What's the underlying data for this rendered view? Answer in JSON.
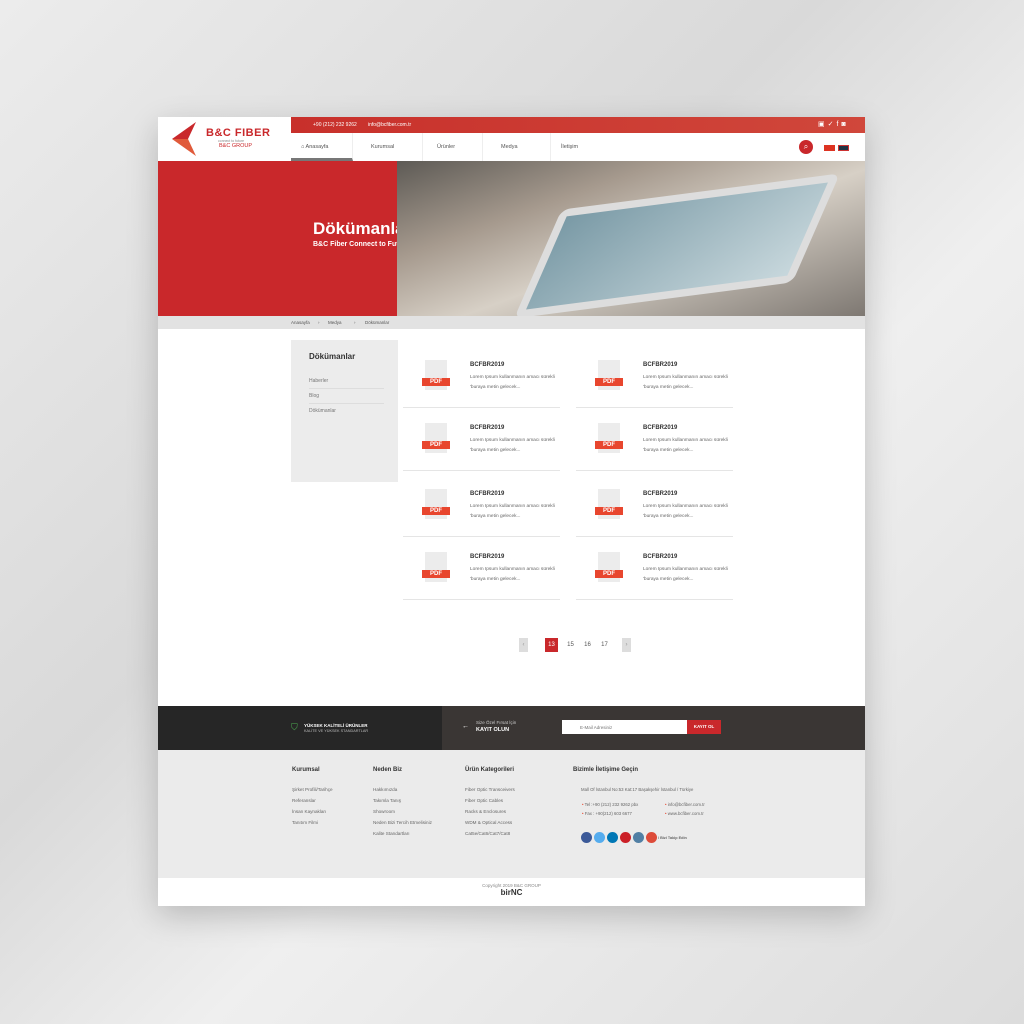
{
  "topbar": {
    "phone": "+90 (212) 232 9262",
    "email": "info@bcfiber.com.tr",
    "social": [
      "linkedin-icon",
      "twitter-icon",
      "facebook-icon",
      "instagram-icon"
    ]
  },
  "logo": {
    "name": "B&C FIBER",
    "tagline": "connect to future",
    "group": "B&C GROUP"
  },
  "nav": {
    "items": [
      "Anasayfa",
      "Kurumsal",
      "Ürünler",
      "Medya",
      "İletişim"
    ]
  },
  "hero": {
    "title": "Dökümanlar",
    "subtitle": "B&C Fiber Connect to Future"
  },
  "breadcrumb": [
    "Anasayfa",
    "Medya",
    "Dökümanlar"
  ],
  "sidebar": {
    "title": "Dökümanlar",
    "items": [
      "Haberler",
      "Blog",
      "Dökümanlar"
    ]
  },
  "documents": [
    {
      "badge": "PDF",
      "title": "BCFBR2019",
      "desc": "Lorem Ipsum kullanmanın amacı sürekli 'buraya metin gelecek..."
    },
    {
      "badge": "PDF",
      "title": "BCFBR2019",
      "desc": "Lorem Ipsum kullanmanın amacı sürekli 'buraya metin gelecek..."
    },
    {
      "badge": "PDF",
      "title": "BCFBR2019",
      "desc": "Lorem Ipsum kullanmanın amacı sürekli 'buraya metin gelecek..."
    },
    {
      "badge": "PDF",
      "title": "BCFBR2019",
      "desc": "Lorem Ipsum kullanmanın amacı sürekli 'buraya metin gelecek..."
    },
    {
      "badge": "PDF",
      "title": "BCFBR2019",
      "desc": "Lorem Ipsum kullanmanın amacı sürekli 'buraya metin gelecek..."
    },
    {
      "badge": "PDF",
      "title": "BCFBR2019",
      "desc": "Lorem Ipsum kullanmanın amacı sürekli 'buraya metin gelecek..."
    },
    {
      "badge": "PDF",
      "title": "BCFBR2019",
      "desc": "Lorem Ipsum kullanmanın amacı sürekli 'buraya metin gelecek..."
    },
    {
      "badge": "PDF",
      "title": "BCFBR2019",
      "desc": "Lorem Ipsum kullanmanın amacı sürekli 'buraya metin gelecek..."
    }
  ],
  "pagination": {
    "pages": [
      "13",
      "15",
      "16",
      "17"
    ],
    "current": "13",
    "prev": "‹",
    "next": "›"
  },
  "band": {
    "quality_title": "YÜKSEK KALİTELİ ÜRÜNLER",
    "quality_sub": "KALİTE VE YÜKSEK STANDARTLAR",
    "promo_small": "Size Özel Fırsat İçin",
    "promo_big": "KAYIT OLUN",
    "email_placeholder": "E-Mail Adresiniz",
    "submit": "KAYIT OL"
  },
  "footer": {
    "cols": [
      {
        "title": "Kurumsal",
        "links": [
          "Şirket Profili/Tarihçe",
          "Referanslar",
          "İnsan Kaynakları",
          "Tanıtım Filmi"
        ]
      },
      {
        "title": "Neden Biz",
        "links": [
          "Hakkımızda",
          "Takımla Tanış",
          "Showroom",
          "Neden Bizi Tercih Etmelisiniz",
          "Kalite Standartları"
        ]
      },
      {
        "title": "Ürün Kategorileri",
        "links": [
          "Fiber Optic Transceivers",
          "Fiber Optic Cables",
          "Racks & Enclosures",
          "WDM & Optical Access",
          "Cat5e/Cat6/Cat7/Cat8"
        ]
      }
    ],
    "contact": {
      "title": "Bizimle İletişime Geçin",
      "address": "Mall Of İstanbul No:53 Kat:17 Başakşehir İstanbul / Türkiye",
      "tel": "Tel :+90 (212) 232 9262 pbx",
      "fax": "Fax : +90(212) 603 6677",
      "email": "info@bcfiber.com.tr",
      "web": "www.bcfiber.com.tr",
      "follow": "/ Bizi Takip Edin"
    },
    "copyright": "Copyright 2019 B&C GROUP",
    "credit": "birNC"
  },
  "colors": {
    "brand": "#c9282b",
    "accent": "#e8462e"
  }
}
